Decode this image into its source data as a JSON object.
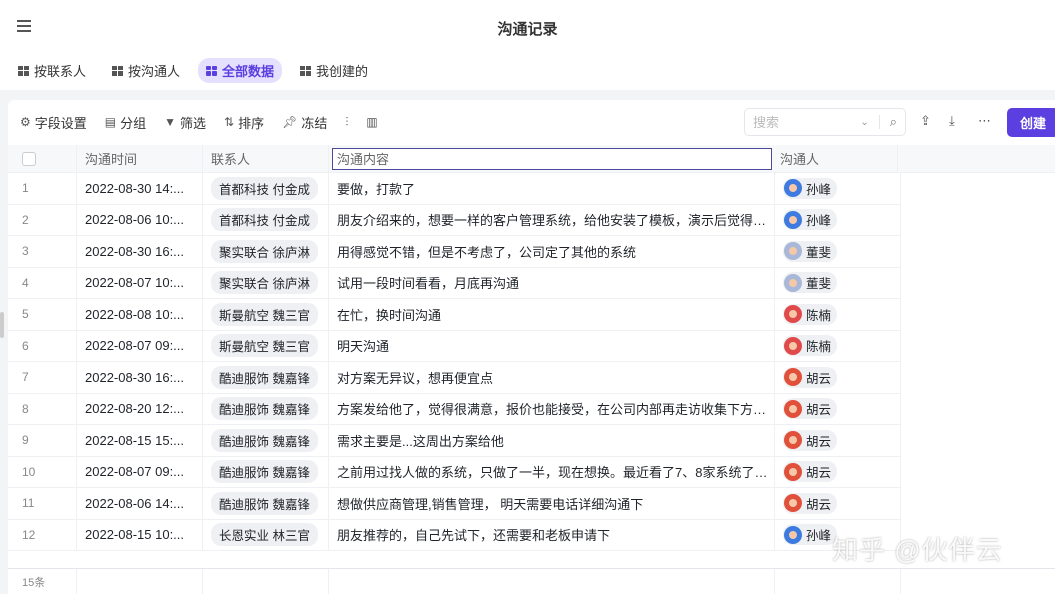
{
  "header": {
    "title": "沟通记录"
  },
  "views": [
    {
      "label": "按联系人"
    },
    {
      "label": "按沟通人"
    },
    {
      "label": "全部数据",
      "active": true
    },
    {
      "label": "我创建的"
    }
  ],
  "toolbar": {
    "fields": "字段设置",
    "group": "分组",
    "filter": "筛选",
    "sort": "排序",
    "freeze": "冻结",
    "search_placeholder": "搜索",
    "create": "创建"
  },
  "columns": {
    "time": "沟通时间",
    "contact": "联系人",
    "content": "沟通内容",
    "person": "沟通人"
  },
  "rows": [
    {
      "n": "1",
      "time": "2022-08-30 14:...",
      "contact": "首都科技 付金成",
      "content": "要做，打款了",
      "person": "孙峰",
      "color": "#3d7be0"
    },
    {
      "n": "2",
      "time": "2022-08-06 10:...",
      "contact": "首都科技 付金成",
      "content": "朋友介绍来的，想要一样的客户管理系统，给他安装了模板，演示后觉得不...",
      "person": "孙峰",
      "color": "#3d7be0"
    },
    {
      "n": "3",
      "time": "2022-08-30 16:...",
      "contact": "聚实联合 徐庐淋",
      "content": "用得感觉不错，但是不考虑了，公司定了其他的系统",
      "person": "董斐",
      "color": "#a9b8d8"
    },
    {
      "n": "4",
      "time": "2022-08-07 10:...",
      "contact": "聚实联合 徐庐淋",
      "content": "试用一段时间看看，月底再沟通",
      "person": "董斐",
      "color": "#a9b8d8"
    },
    {
      "n": "5",
      "time": "2022-08-08 10:...",
      "contact": "斯曼航空 魏三官",
      "content": "在忙，换时间沟通",
      "person": "陈楠",
      "color": "#e04a4a"
    },
    {
      "n": "6",
      "time": "2022-08-07 09:...",
      "contact": "斯曼航空 魏三官",
      "content": "明天沟通",
      "person": "陈楠",
      "color": "#e04a4a"
    },
    {
      "n": "7",
      "time": "2022-08-30 16:...",
      "contact": "酷迪服饰 魏嘉锋",
      "content": "对方案无异议，想再便宜点",
      "person": "胡云",
      "color": "#e0503a"
    },
    {
      "n": "8",
      "time": "2022-08-20 12:...",
      "contact": "酷迪服饰 魏嘉锋",
      "content": "方案发给他了，觉得很满意，报价也能接受，在公司内部再走访收集下方案...",
      "person": "胡云",
      "color": "#e0503a"
    },
    {
      "n": "9",
      "time": "2022-08-15 15:...",
      "contact": "酷迪服饰 魏嘉锋",
      "content": "需求主要是...这周出方案给他",
      "person": "胡云",
      "color": "#e0503a"
    },
    {
      "n": "10",
      "time": "2022-08-07 09:...",
      "contact": "酷迪服饰 魏嘉锋",
      "content": "之前用过找人做的系统，只做了一半，现在想换。最近看了7、8家系统了，...",
      "person": "胡云",
      "color": "#e0503a"
    },
    {
      "n": "11",
      "time": "2022-08-06 14:...",
      "contact": "酷迪服饰 魏嘉锋",
      "content": "想做供应商管理,销售管理， 明天需要电话详细沟通下",
      "person": "胡云",
      "color": "#e0503a"
    },
    {
      "n": "12",
      "time": "2022-08-15 10:...",
      "contact": "长恩实业 林三官",
      "content": "朋友推荐的，自己先试下，还需要和老板申请下",
      "person": "孙峰",
      "color": "#3d7be0"
    }
  ],
  "footer": {
    "count": "15条"
  },
  "watermark": "知乎 @伙伴云"
}
